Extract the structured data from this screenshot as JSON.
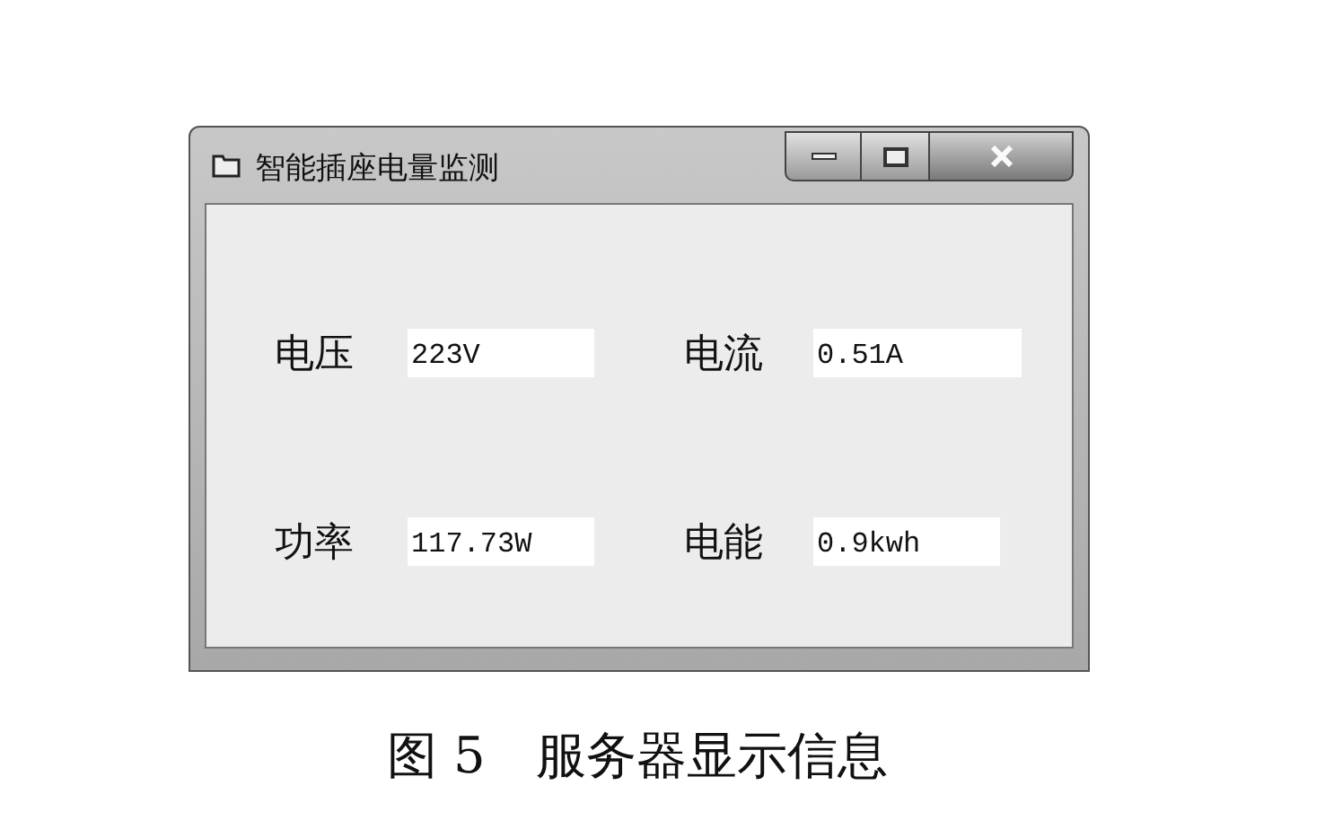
{
  "window": {
    "title": "智能插座电量监测"
  },
  "fields": [
    {
      "label": "电压",
      "value": "223V"
    },
    {
      "label": "电流",
      "value": "0.51A"
    },
    {
      "label": "功率",
      "value": "117.73W"
    },
    {
      "label": "电能",
      "value": "0.9kwh"
    }
  ],
  "caption": "图 5　服务器显示信息"
}
